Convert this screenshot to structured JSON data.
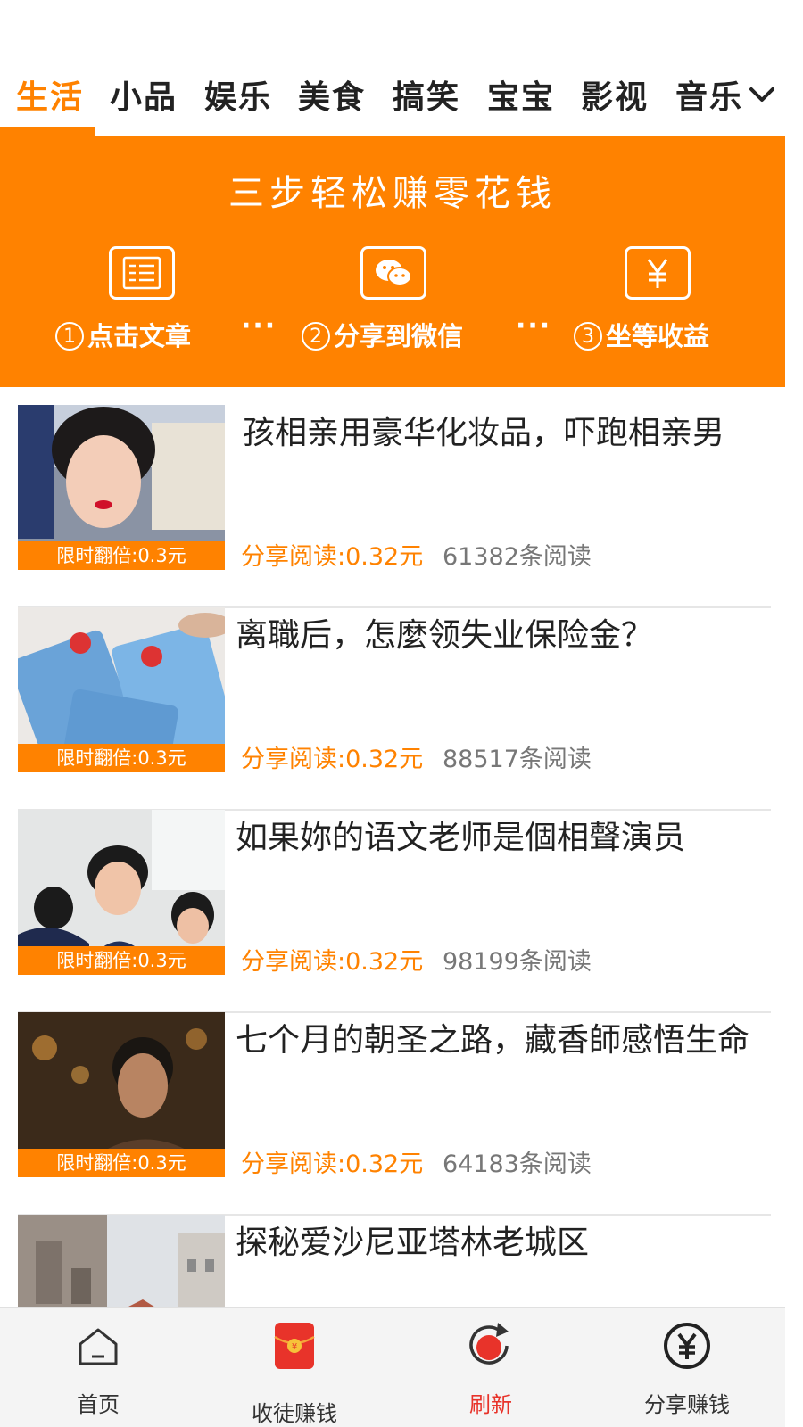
{
  "category_tabs": {
    "items": [
      "生活",
      "小品",
      "娱乐",
      "美食",
      "搞笑",
      "宝宝",
      "影视",
      "音乐"
    ],
    "active_index": 0,
    "more_icon": "chevron-down-icon"
  },
  "banner": {
    "title": "三步轻松赚零花钱",
    "steps": [
      {
        "num": "1",
        "label": "点击文章",
        "icon": "article-list-icon"
      },
      {
        "num": "2",
        "label": "分享到微信",
        "icon": "wechat-icon"
      },
      {
        "num": "3",
        "label": "坐等收益",
        "icon": "yuan-icon"
      }
    ],
    "separator": "···"
  },
  "articles": [
    {
      "title": "孩相亲用豪华化妆品，吓跑相亲男",
      "badge": "限时翻倍:0.3元",
      "earn": "分享阅读:0.32元",
      "reads": "61382条阅读"
    },
    {
      "title": "离職后，怎麼领失业保险金？",
      "badge": "限时翻倍:0.3元",
      "earn": "分享阅读:0.32元",
      "reads": "88517条阅读"
    },
    {
      "title": "如果妳的语文老师是個相聲演员",
      "badge": "限时翻倍:0.3元",
      "earn": "分享阅读:0.32元",
      "reads": "98199条阅读"
    },
    {
      "title": "七个月的朝圣之路，藏香師感悟生命",
      "badge": "限时翻倍:0.3元",
      "earn": "分享阅读:0.32元",
      "reads": "64183条阅读"
    },
    {
      "title": "探秘爱沙尼亚塔林老城区",
      "badge": "",
      "earn": "",
      "reads": ""
    }
  ],
  "bottom_nav": {
    "items": [
      {
        "label": "首页",
        "icon": "home-icon"
      },
      {
        "label": "收徒赚钱",
        "icon": "red-envelope-icon"
      },
      {
        "label": "刷新",
        "icon": "refresh-icon"
      },
      {
        "label": "分享赚钱",
        "icon": "yuan-circle-icon"
      }
    ],
    "active_index": 2
  },
  "colors": {
    "accent": "#ff8200",
    "refresh_red": "#e8332a",
    "nav_bg": "#f4f4f4"
  }
}
